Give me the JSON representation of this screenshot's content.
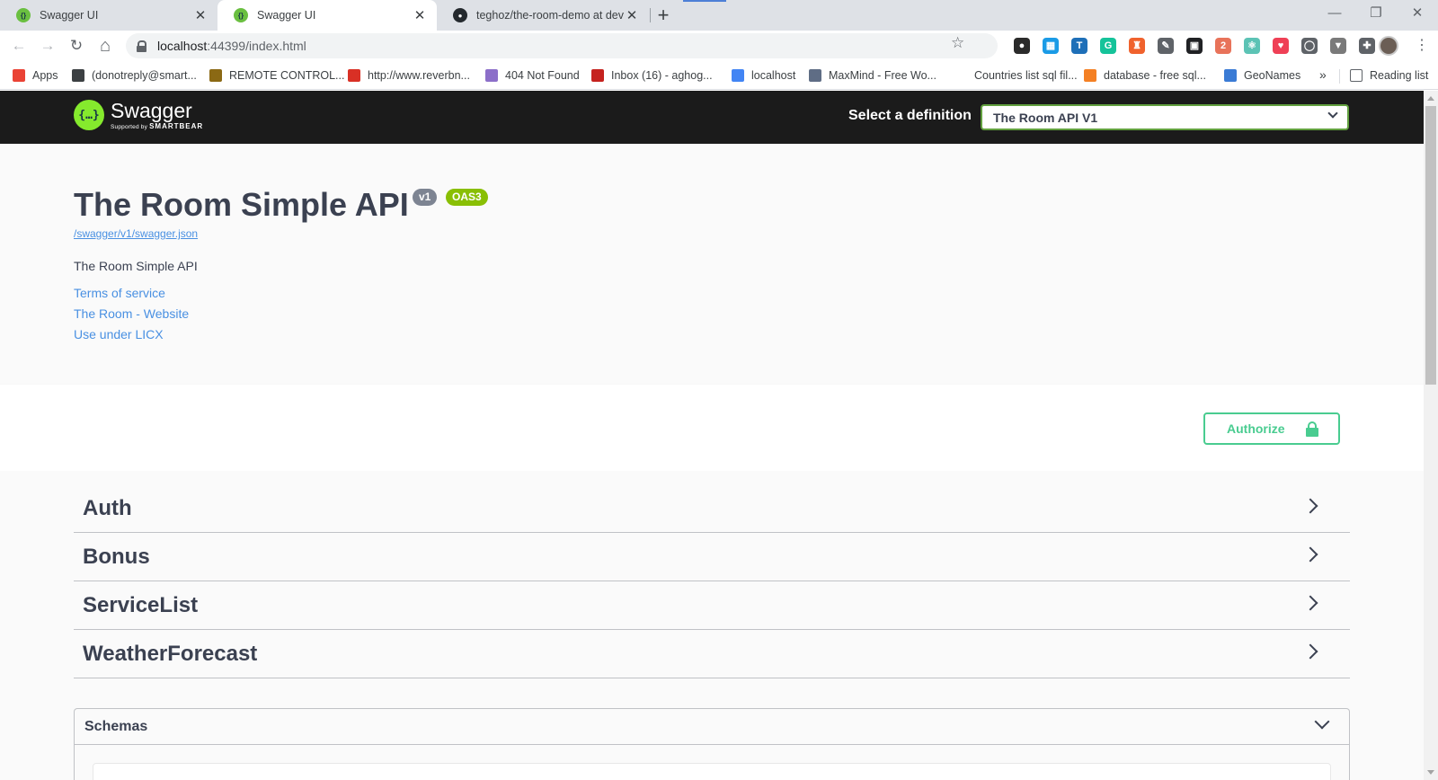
{
  "browser": {
    "tabs": [
      {
        "title": "Swagger UI",
        "active": false
      },
      {
        "title": "Swagger UI",
        "active": true
      },
      {
        "title": "teghoz/the-room-demo at devel",
        "active": false
      }
    ],
    "tab_close": "✕",
    "new_tab": "+",
    "window_controls": {
      "minimize": "—",
      "restore": "❐",
      "close": "✕"
    },
    "nav": {
      "back": "←",
      "forward": "→",
      "reload": "↻",
      "home": "⌂"
    },
    "url": {
      "host": "localhost",
      "path": ":44399/index.html"
    },
    "bookmark_star": "☆",
    "extensions": [
      {
        "icon": "ninja-extension-icon",
        "color": "#2b2b2b",
        "glyph": "●"
      },
      {
        "icon": "calendar-extension-icon",
        "color": "#1a9be6",
        "glyph": "▦"
      },
      {
        "icon": "translate-extension-icon",
        "color": "#1e6fb8",
        "glyph": "T"
      },
      {
        "icon": "grammarly-extension-icon",
        "color": "#15c39a",
        "glyph": "G"
      },
      {
        "icon": "ghost-extension-icon",
        "color": "#f0622d",
        "glyph": "♜"
      },
      {
        "icon": "dropper-extension-icon",
        "color": "#5f6368",
        "glyph": "✎"
      },
      {
        "icon": "qr-extension-icon",
        "color": "#202124",
        "glyph": "▣"
      },
      {
        "icon": "network-extension-icon",
        "color": "#e8735a",
        "glyph": "2"
      },
      {
        "icon": "react-extension-icon",
        "color": "#5cc3b5",
        "glyph": "⚛"
      },
      {
        "icon": "pocket-extension-icon",
        "color": "#ef4056",
        "glyph": "♥"
      },
      {
        "icon": "code-extension-icon",
        "color": "#5f6368",
        "glyph": "◯"
      },
      {
        "icon": "vue-extension-icon",
        "color": "#7a7a7a",
        "glyph": "▼"
      },
      {
        "icon": "puzzle-extension-icon",
        "color": "#5f6368",
        "glyph": "✚"
      }
    ],
    "menu": "⋮",
    "bookmarks": [
      {
        "label": "Apps",
        "color": "#ea4335"
      },
      {
        "label": "(donotreply@smart...",
        "color": "#3c4043"
      },
      {
        "label": "REMOTE CONTROL...",
        "color": "#8b6914"
      },
      {
        "label": "http://www.reverbn...",
        "color": "#d93025"
      },
      {
        "label": "404 Not Found",
        "color": "#8c6fc9"
      },
      {
        "label": "Inbox (16) - aghog...",
        "color": "#c5221f"
      },
      {
        "label": "localhost",
        "color": "#4285f4"
      },
      {
        "label": "MaxMind - Free Wo...",
        "color": "#5f6d85"
      },
      {
        "label": "Countries list sql fil...",
        "color": "#ffffff"
      },
      {
        "label": "database - free sql...",
        "color": "#f48024"
      },
      {
        "label": "GeoNames",
        "color": "#3a7bd5"
      }
    ],
    "bookmarks_more": "»",
    "reading_list": "Reading list"
  },
  "swagger": {
    "logo_word": "Swagger",
    "logo_sub_prefix": "Supported by ",
    "logo_sub_brand": "SMARTBEAR",
    "logo_mark": "{…}",
    "definition_label": "Select a definition",
    "definition_selected": "The Room API V1",
    "info": {
      "title": "The Room Simple API",
      "version_badge": "v1",
      "oas_badge": "OAS3",
      "spec_url": "/swagger/v1/swagger.json",
      "description": "The Room Simple API",
      "links": [
        "Terms of service",
        "The Room - Website",
        "Use under LICX"
      ]
    },
    "authorize_label": "Authorize",
    "tags": [
      "Auth",
      "Bonus",
      "ServiceList",
      "WeatherForecast"
    ],
    "schemas_title": "Schemas"
  },
  "colors": {
    "topbar": "#1b1b1b",
    "brand_green": "#85ea2d",
    "authorize": "#49cc90",
    "link": "#4990e2",
    "text": "#3b4151"
  }
}
